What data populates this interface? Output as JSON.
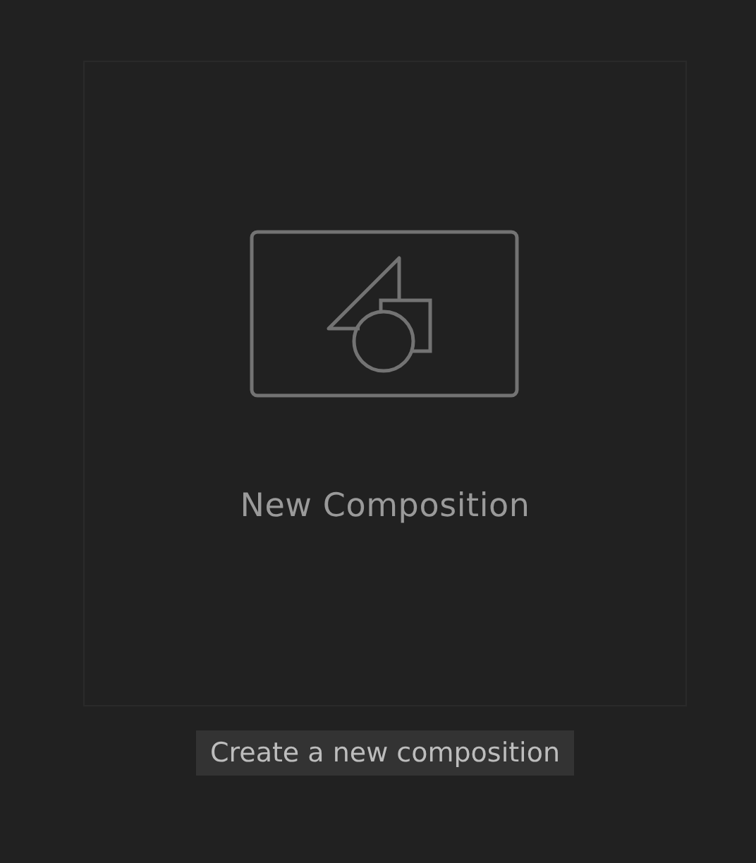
{
  "card": {
    "label": "New Composition"
  },
  "tooltip": {
    "text": "Create a new composition"
  }
}
